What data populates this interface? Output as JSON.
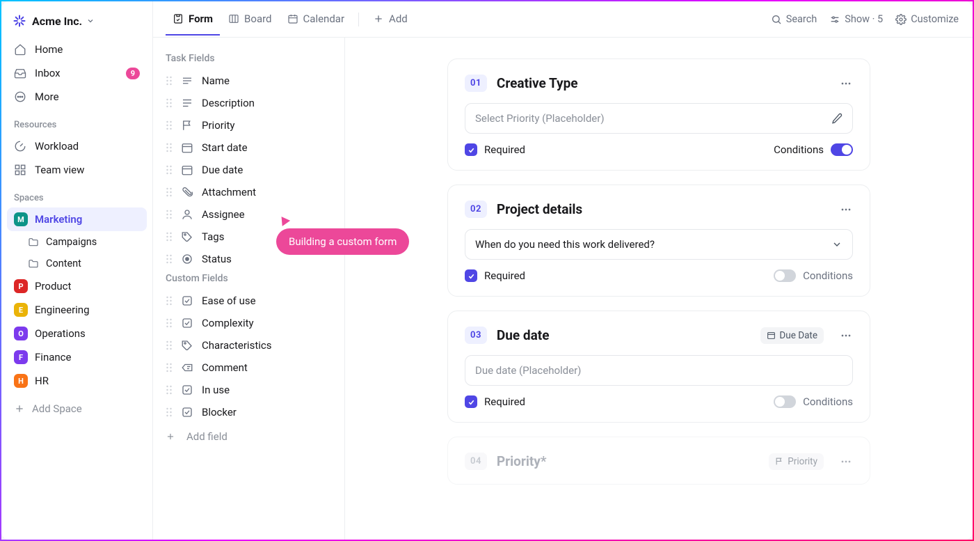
{
  "workspace": {
    "name": "Acme Inc.",
    "inbox_count": "9"
  },
  "nav": {
    "home": "Home",
    "inbox": "Inbox",
    "more": "More"
  },
  "resources": {
    "heading": "Resources",
    "workload": "Workload",
    "teamview": "Team view"
  },
  "spaces": {
    "heading": "Spaces",
    "items": [
      {
        "letter": "M",
        "name": "Marketing",
        "color": "#0d9488",
        "active": true
      },
      {
        "letter": "P",
        "name": "Product",
        "color": "#dc2626"
      },
      {
        "letter": "E",
        "name": "Engineering",
        "color": "#eab308"
      },
      {
        "letter": "O",
        "name": "Operations",
        "color": "#7c3aed"
      },
      {
        "letter": "F",
        "name": "Finance",
        "color": "#7c3aed"
      },
      {
        "letter": "H",
        "name": "HR",
        "color": "#f97316"
      }
    ],
    "sub_campaigns": "Campaigns",
    "sub_content": "Content",
    "add_space": "Add Space"
  },
  "tabs": {
    "form": "Form",
    "board": "Board",
    "calendar": "Calendar",
    "add": "Add"
  },
  "topbar_right": {
    "search": "Search",
    "show": "Show · 5",
    "customize": "Customize"
  },
  "fields": {
    "heading_task": "Task Fields",
    "heading_custom": "Custom Fields",
    "task": [
      "Name",
      "Description",
      "Priority",
      "Start date",
      "Due date",
      "Attachment",
      "Assignee",
      "Tags",
      "Status"
    ],
    "custom": [
      "Ease of use",
      "Complexity",
      "Characteristics",
      "Comment",
      "In use",
      "Blocker"
    ],
    "add": "Add field"
  },
  "questions": [
    {
      "num": "01",
      "title": "Creative Type",
      "placeholder": "Select Priority (Placeholder)",
      "filled": false,
      "trailing": "edit",
      "required": "Required",
      "conditions": "Conditions",
      "toggleOn": true,
      "conditionsRight": true
    },
    {
      "num": "02",
      "title": "Project details",
      "placeholder": "When do you need this work delivered?",
      "filled": true,
      "trailing": "chevron",
      "required": "Required",
      "conditions": "Conditions",
      "toggleOn": false
    },
    {
      "num": "03",
      "title": "Due date",
      "placeholder": "Due date (Placeholder)",
      "filled": false,
      "trailing": "none",
      "pill": "Due Date",
      "pillIcon": "calendar",
      "required": "Required",
      "conditions": "Conditions",
      "toggleOn": false
    },
    {
      "num": "04",
      "title": "Priority*",
      "placeholder": "",
      "pill": "Priority",
      "pillIcon": "flag",
      "muted": true
    }
  ],
  "tooltip": {
    "text": "Building a custom form"
  }
}
